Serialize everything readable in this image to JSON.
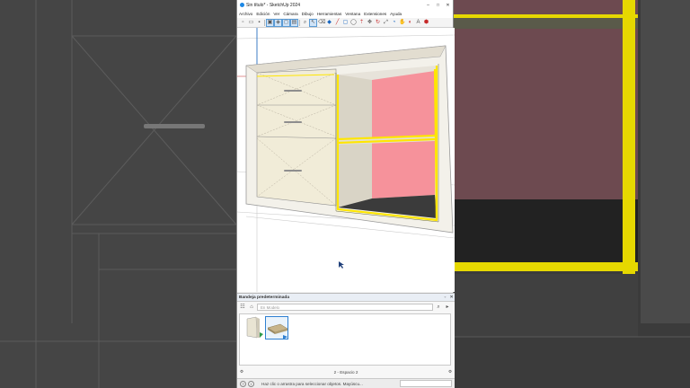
{
  "window": {
    "title": "Sin título* - SketchUp 2024",
    "controls": {
      "minimize": "–",
      "maximize": "□",
      "close": "✕"
    }
  },
  "menu": [
    "Archivo",
    "Edición",
    "Ver",
    "Cámara",
    "Dibujo",
    "Herramientas",
    "Ventana",
    "Extensiones",
    "Ayuda"
  ],
  "toolbar": {
    "icons": [
      "select-icon",
      "eraser-icon",
      "paint-icon",
      "line-icon",
      "rectangle-icon",
      "circle-icon",
      "push-pull-icon",
      "move-icon",
      "rotate-icon",
      "scale-icon",
      "orbit-icon",
      "pan-icon",
      "zoom-icon",
      "tape-icon",
      "text-icon",
      "axes-icon",
      "view-icon"
    ]
  },
  "tray": {
    "title": "Bandeja predeterminada",
    "search_placeholder": "En Modelo",
    "footer_left": "⚙",
    "footer_mid": "2 - Espacio 2",
    "footer_right": "⚙"
  },
  "status": {
    "message": "Haz clic o arrastra para seleccionar objetos. Mayúscu..."
  },
  "colors": {
    "selection_yellow": "#ffeb00",
    "back_panel_pink": "#f5969f",
    "cabinet_wood": "#e8e2d6",
    "accent_blue": "#2f80d1"
  }
}
